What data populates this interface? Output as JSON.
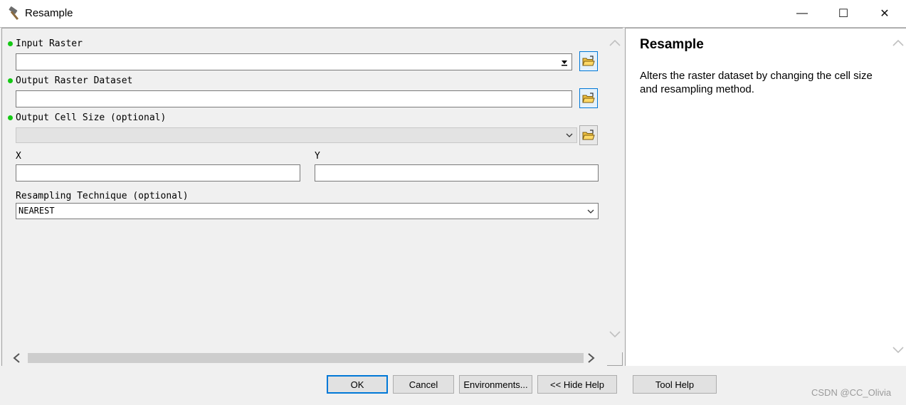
{
  "window": {
    "title": "Resample",
    "controls": {
      "minimize": "—",
      "maximize": "☐",
      "close": "✕"
    }
  },
  "form": {
    "input_raster": {
      "label": "Input Raster",
      "value": ""
    },
    "output_raster": {
      "label": "Output Raster Dataset",
      "value": ""
    },
    "cell_size": {
      "label": "Output Cell Size (optional)",
      "value": ""
    },
    "x": {
      "label": "X",
      "value": ""
    },
    "y": {
      "label": "Y",
      "value": ""
    },
    "resampling": {
      "label": "Resampling Technique (optional)",
      "value": "NEAREST"
    }
  },
  "help": {
    "title": "Resample",
    "description": "Alters the raster dataset by changing the cell size and resampling method."
  },
  "buttons": {
    "ok": "OK",
    "cancel": "Cancel",
    "environments": "Environments...",
    "hide_help": "<< Hide Help",
    "tool_help": "Tool Help"
  },
  "watermark": "CSDN @CC_Olivia",
  "colors": {
    "required_dot": "#14c814",
    "focus_border": "#0078d7"
  }
}
